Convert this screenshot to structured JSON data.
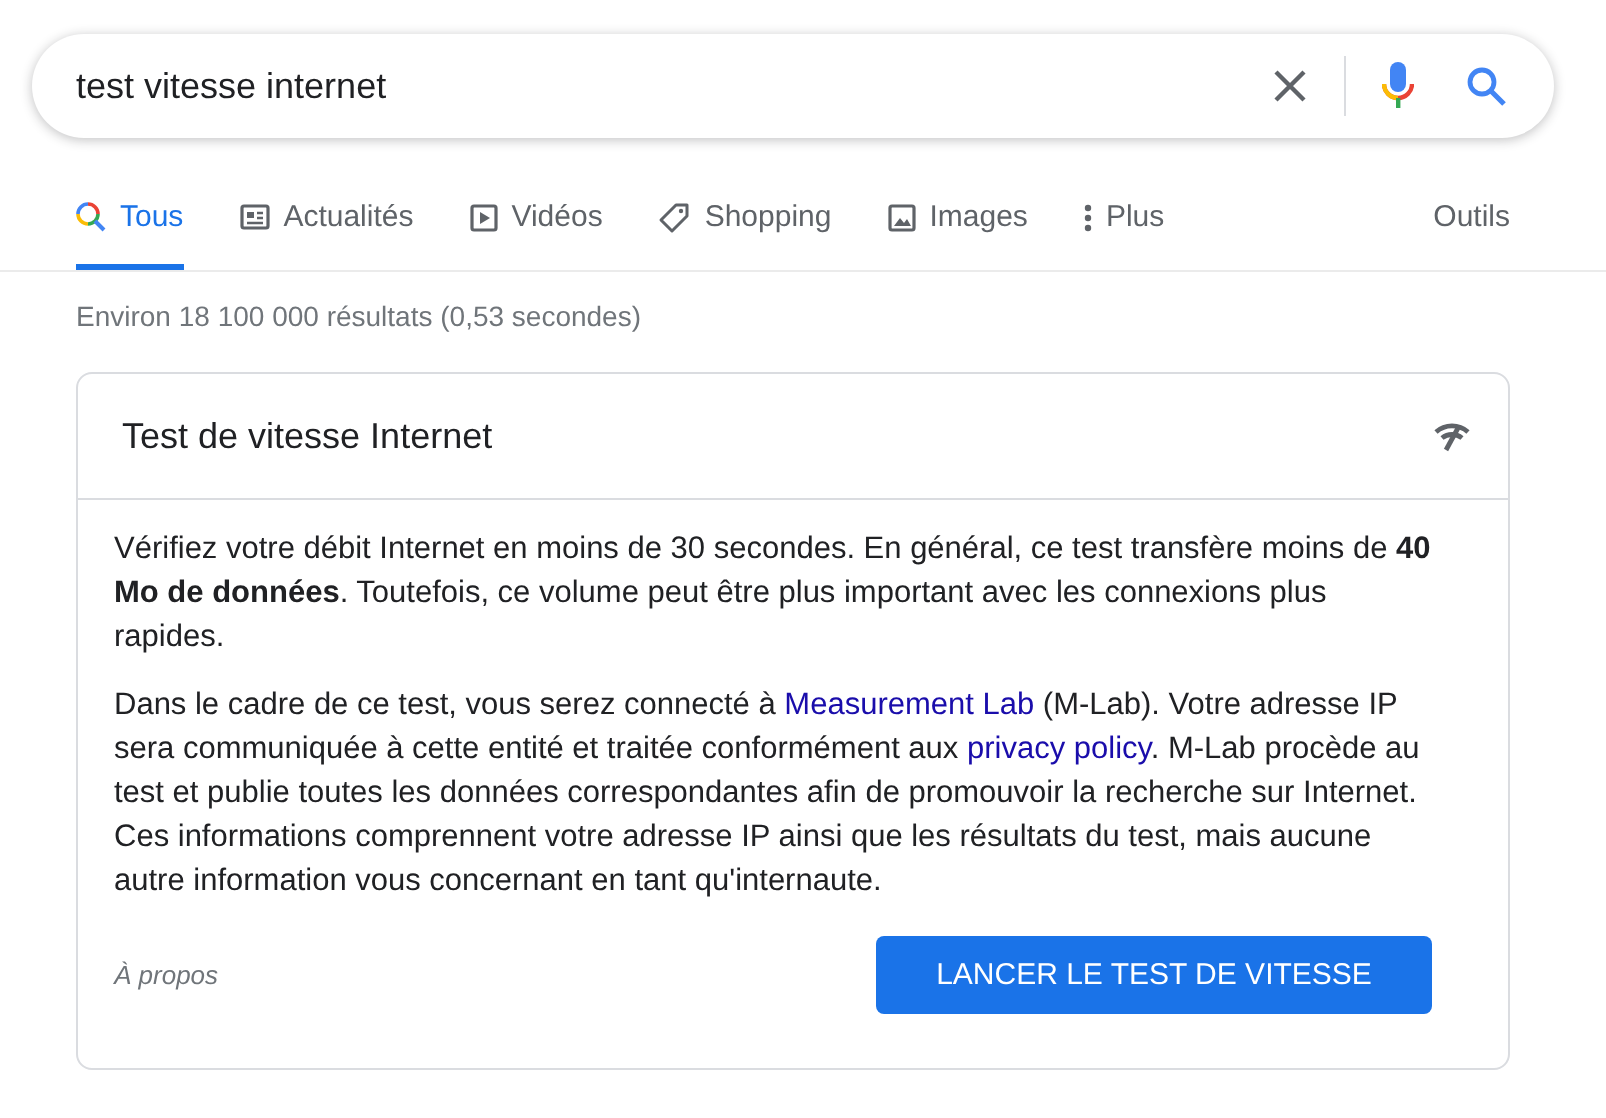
{
  "search": {
    "value": "test vitesse internet"
  },
  "tabs": [
    {
      "label": "Tous",
      "kind": "search",
      "selected": true
    },
    {
      "label": "Actualités",
      "kind": "news",
      "selected": false
    },
    {
      "label": "Vidéos",
      "kind": "video",
      "selected": false
    },
    {
      "label": "Shopping",
      "kind": "tag",
      "selected": false
    },
    {
      "label": "Images",
      "kind": "image",
      "selected": false
    },
    {
      "label": "Plus",
      "kind": "more",
      "selected": false
    }
  ],
  "tools": "Outils",
  "stats": "Environ 18 100 000 résultats (0,53 secondes)",
  "card": {
    "title": "Test de vitesse Internet",
    "paragraph_1": "Vérifiez votre débit Internet en moins de 30 secondes. En général, ce test transfère moins de **40 Mo de données**. Toutefois, ce volume peut être plus important avec les connexions plus rapides.",
    "paragraph_2": [
      {
        "kind": "text",
        "text": "Dans le cadre de ce test, vous serez connecté à "
      },
      {
        "kind": "link",
        "text": "Measurement Lab"
      },
      {
        "kind": "text",
        "text": " (M-Lab). Votre adresse IP sera communiquée à cette entité et traitée conformément aux "
      },
      {
        "kind": "link",
        "text": "privacy policy"
      },
      {
        "kind": "text",
        "text": ". M-Lab procède au test et publie toutes les données correspondantes afin de promouvoir la recherche sur Internet. Ces informations comprennent votre adresse IP ainsi que les résultats du test, mais aucune autre information vous concernant en tant qu'internaute."
      }
    ],
    "about": "À propos",
    "button": "LANCER LE TEST DE VITESSE"
  }
}
